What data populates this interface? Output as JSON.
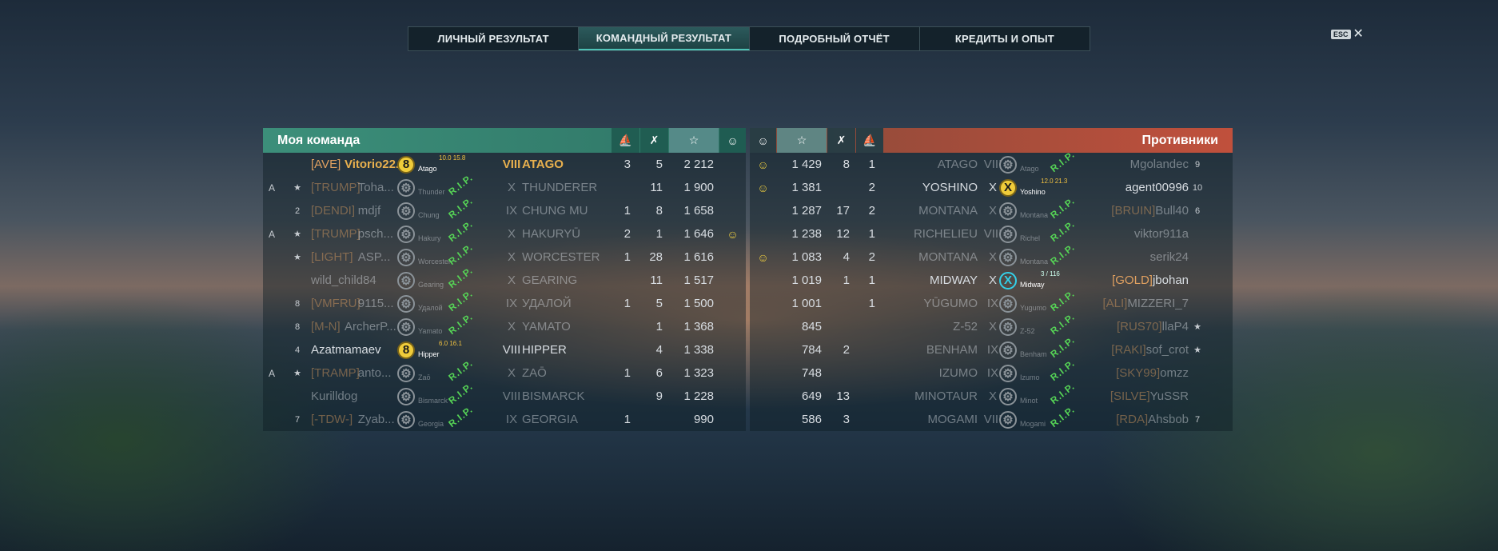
{
  "tabs": [
    "ЛИЧНЫЙ РЕЗУЛЬТАТ",
    "КОМАНДНЫЙ РЕЗУЛЬТАТ",
    "ПОДРОБНЫЙ ОТЧЁТ",
    "КРЕДИТЫ И ОПЫТ"
  ],
  "active_tab": 1,
  "esc_key": "ESC",
  "close_glyph": "✕",
  "my_team": {
    "title": "Моя команда",
    "header_icons": [
      "torpedo-icon",
      "frag-icon",
      "star-icon",
      "medal-icon"
    ],
    "rows": [
      {
        "clan": "[AVE]",
        "player": "Vitorio22...",
        "ship_tier_badge": "8",
        "ship_short": "Atago",
        "hp": "10.0  15.8",
        "tier": "VIII",
        "ship": "ATAGO",
        "torp": "3",
        "frags": "5",
        "xp": "2 212",
        "medal": "",
        "alive": true,
        "highlight": true
      },
      {
        "clan": "[TRUMP]",
        "player": "Toha...",
        "ship_short": "Thunder",
        "tier": "X",
        "ship": "THUNDERER",
        "torp": "",
        "frags": "11",
        "xp": "1 900",
        "medal": "",
        "alive": false,
        "shield": "A",
        "rank": "★"
      },
      {
        "clan": "[DENDI]",
        "player": "mdjf",
        "ship_short": "Chung",
        "tier": "IX",
        "ship": "CHUNG MU",
        "torp": "1",
        "frags": "8",
        "xp": "1 658",
        "medal": "",
        "alive": false,
        "rank": "2"
      },
      {
        "clan": "[TRUMP]",
        "player": "psch...",
        "ship_short": "Hakury",
        "tier": "X",
        "ship": "HAKURYŪ",
        "torp": "2",
        "frags": "1",
        "xp": "1 646",
        "medal": "☺",
        "alive": false,
        "shield": "A",
        "rank": "★"
      },
      {
        "clan": "[LIGHT]",
        "player": "ASP...",
        "ship_short": "Worcester",
        "tier": "X",
        "ship": "WORCESTER",
        "torp": "1",
        "frags": "28",
        "xp": "1 616",
        "medal": "",
        "alive": false,
        "rank": "★"
      },
      {
        "clan": "",
        "player": "wild_child84",
        "ship_short": "Gearing",
        "tier": "X",
        "ship": "GEARING",
        "torp": "",
        "frags": "11",
        "xp": "1 517",
        "medal": "",
        "alive": false
      },
      {
        "clan": "[VMFRU]",
        "player": "9115...",
        "ship_short": "Удалой",
        "tier": "IX",
        "ship": "УДАЛОЙ",
        "torp": "1",
        "frags": "5",
        "xp": "1 500",
        "medal": "",
        "alive": false,
        "rank": "8"
      },
      {
        "clan": "[M-N]",
        "player": "ArcherP...",
        "ship_short": "Yamato",
        "tier": "X",
        "ship": "YAMATO",
        "torp": "",
        "frags": "1",
        "xp": "1 368",
        "medal": "",
        "alive": false,
        "rank": "8"
      },
      {
        "clan": "",
        "player": "Azatmamaev",
        "ship_tier_badge": "8",
        "ship_short": "Hipper",
        "hp": "6.0  16.1",
        "tier": "VIII",
        "ship": "HIPPER",
        "torp": "",
        "frags": "4",
        "xp": "1 338",
        "medal": "",
        "alive": true,
        "rank": "4"
      },
      {
        "clan": "[TRAMP]",
        "player": "anto...",
        "ship_short": "Zaō",
        "tier": "X",
        "ship": "ZAŌ",
        "torp": "1",
        "frags": "6",
        "xp": "1 323",
        "medal": "",
        "alive": false,
        "shield": "A",
        "rank": "★"
      },
      {
        "clan": "",
        "player": "Kurilldog",
        "ship_short": "Bismarck",
        "tier": "VIII",
        "ship": "BISMARCK",
        "torp": "",
        "frags": "9",
        "xp": "1 228",
        "medal": "",
        "alive": false
      },
      {
        "clan": "[-TDW-]",
        "player": "Zyab...",
        "ship_short": "Georgia",
        "tier": "IX",
        "ship": "GEORGIA",
        "torp": "1",
        "frags": "",
        "xp": "990",
        "medal": "",
        "alive": false,
        "rank": "7"
      }
    ]
  },
  "enemy_team": {
    "title": "Противники",
    "header_icons": [
      "medal-icon",
      "star-icon",
      "frag-icon",
      "torpedo-icon"
    ],
    "rows": [
      {
        "medal": "☺",
        "xp": "1 429",
        "frags": "8",
        "torp": "1",
        "ship": "ATAGO",
        "tier": "VIII",
        "ship_short": "Atago",
        "clan": "",
        "player": "Mgolandec",
        "alive": false,
        "rank": "9"
      },
      {
        "medal": "☺",
        "xp": "1 381",
        "frags": "",
        "torp": "2",
        "ship": "YOSHINO",
        "tier": "X",
        "ship_short": "Yoshino",
        "ship_tier_badge": "X",
        "hp": "12.0  21.3",
        "clan": "",
        "player": "agent00996",
        "alive": true,
        "rank": "10"
      },
      {
        "medal": "",
        "xp": "1 287",
        "frags": "17",
        "torp": "2",
        "ship": "MONTANA",
        "tier": "X",
        "ship_short": "Montana",
        "clan": "[BRUIN]",
        "player": "Bull40",
        "alive": false,
        "rank": "6"
      },
      {
        "medal": "",
        "xp": "1 238",
        "frags": "12",
        "torp": "1",
        "ship": "RICHELIEU",
        "tier": "VIII",
        "ship_short": "Richel",
        "clan": "",
        "player": "viktor911a",
        "alive": false
      },
      {
        "medal": "☺",
        "xp": "1 083",
        "frags": "4",
        "torp": "2",
        "ship": "MONTANA",
        "tier": "X",
        "ship_short": "Montana",
        "clan": "",
        "player": "serik24",
        "alive": false
      },
      {
        "medal": "",
        "xp": "1 019",
        "frags": "1",
        "torp": "1",
        "ship": "MIDWAY",
        "tier": "X",
        "ship_short": "Midway",
        "ship_tier_badge": "X",
        "hp": "3 / 116",
        "clan": "[GOLD]",
        "player": "jbohan",
        "alive": true,
        "cyan": true
      },
      {
        "medal": "",
        "xp": "1 001",
        "frags": "",
        "torp": "1",
        "ship": "YŪGUMO",
        "tier": "IX",
        "ship_short": "Yugumo",
        "clan": "[ALI]",
        "player": "MIZZERI_7",
        "alive": false
      },
      {
        "medal": "",
        "xp": "845",
        "frags": "",
        "torp": "",
        "ship": "Z-52",
        "tier": "X",
        "ship_short": "Z-52",
        "clan": "[RUS70]",
        "player": "llaP4",
        "alive": false,
        "rank": "★"
      },
      {
        "medal": "",
        "xp": "784",
        "frags": "2",
        "torp": "",
        "ship": "BENHAM",
        "tier": "IX",
        "ship_short": "Benham",
        "clan": "[RAKI]",
        "player": "sof_crot",
        "alive": false,
        "rank": "★"
      },
      {
        "medal": "",
        "xp": "748",
        "frags": "",
        "torp": "",
        "ship": "IZUMO",
        "tier": "IX",
        "ship_short": "Izumo",
        "clan": "[SKY99]",
        "player": "omzz",
        "alive": false
      },
      {
        "medal": "",
        "xp": "649",
        "frags": "13",
        "torp": "",
        "ship": "MINOTAUR",
        "tier": "X",
        "ship_short": "Minot",
        "clan": "[SILVE]",
        "player": "YuSSR",
        "alive": false
      },
      {
        "medal": "",
        "xp": "586",
        "frags": "3",
        "torp": "",
        "ship": "MOGAMI",
        "tier": "VIII",
        "ship_short": "Mogami",
        "clan": "[RDA]",
        "player": "Ahsbob",
        "alive": false,
        "rank": "7"
      }
    ]
  },
  "rip_text": "R.I.P."
}
